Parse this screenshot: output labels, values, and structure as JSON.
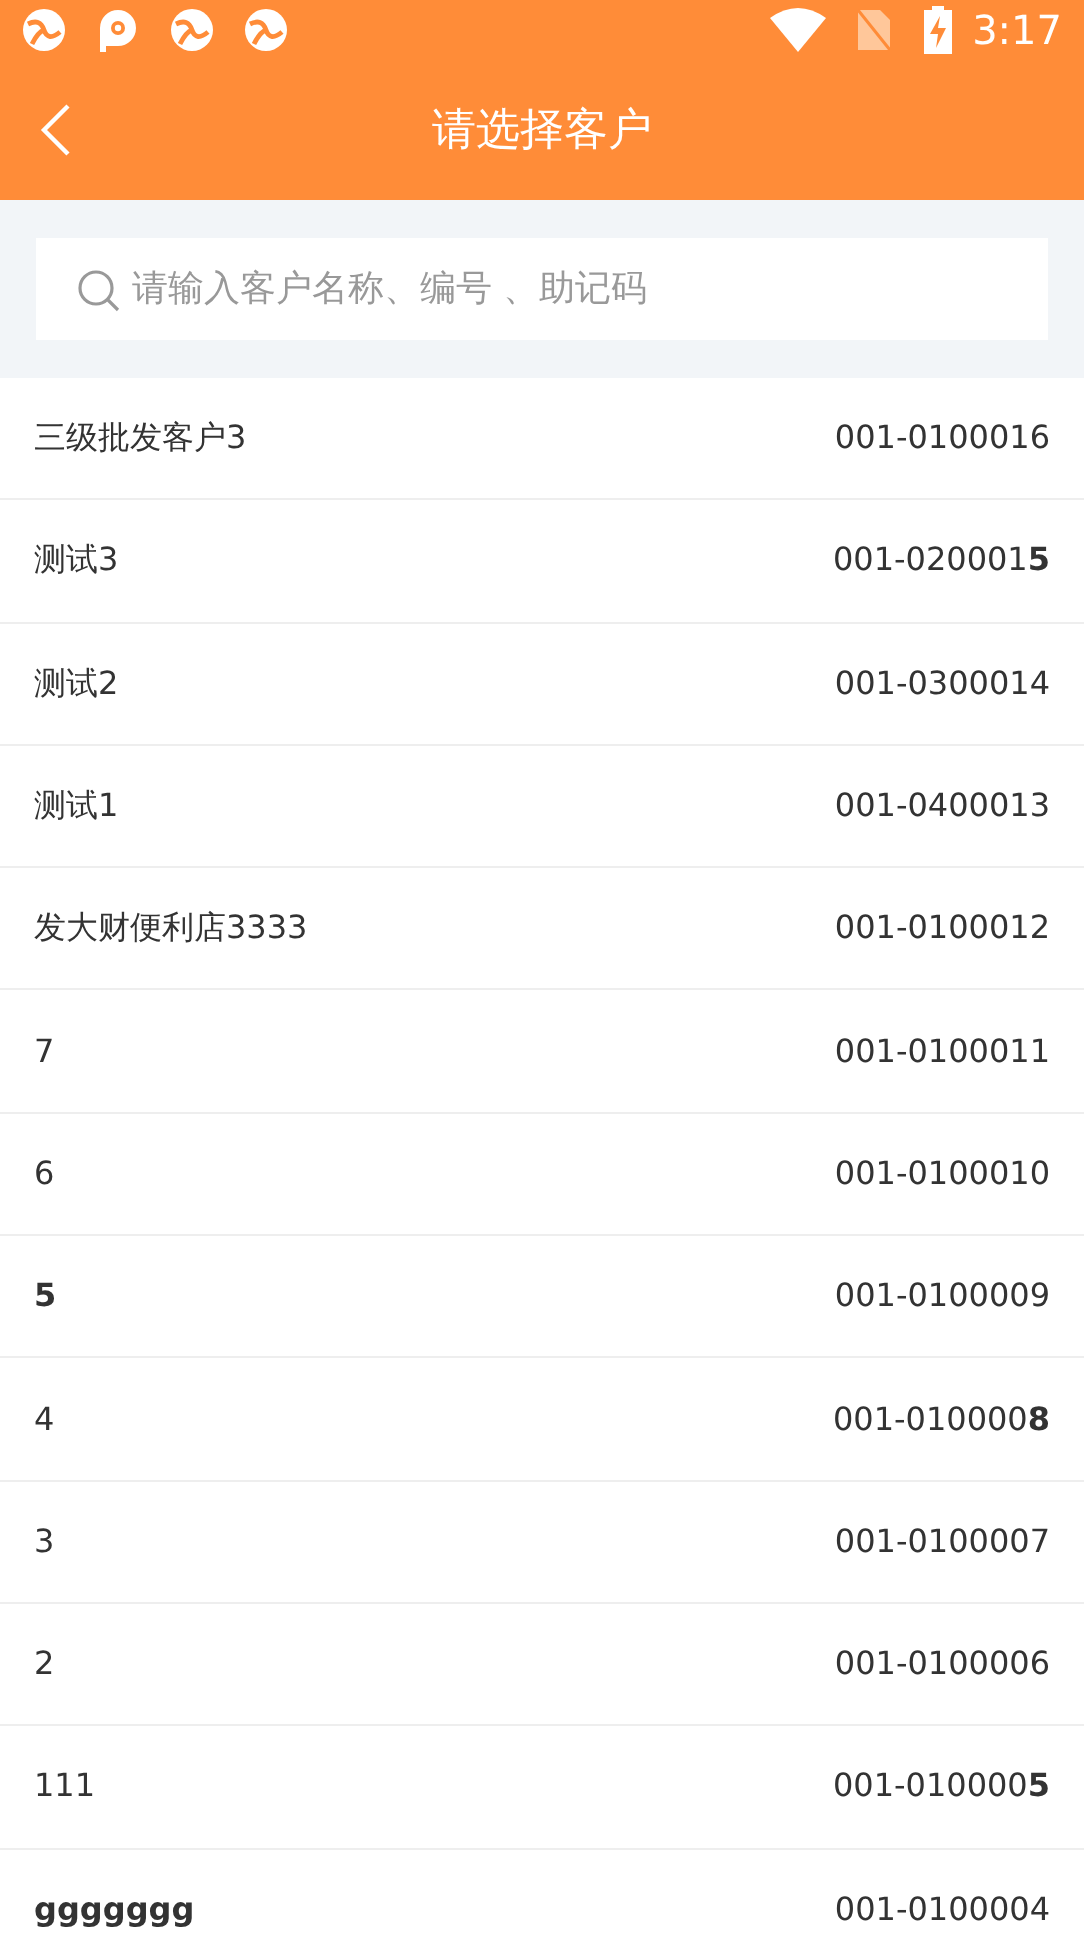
{
  "status_bar": {
    "time": "3:17"
  },
  "header": {
    "title": "请选择客户"
  },
  "search": {
    "placeholder": "请输入客户名称、编号 、助记码"
  },
  "customers": [
    {
      "name": "三级批发客户3",
      "code": "001-0100016",
      "bold": false
    },
    {
      "name": "测试3",
      "code": "001-020001**5**",
      "bold": false
    },
    {
      "name": "测试2",
      "code": "001-0300014",
      "bold": false
    },
    {
      "name": "测试1",
      "code": "001-0400013",
      "bold": false
    },
    {
      "name": "发大财便利店3333",
      "code": "001-0100012",
      "bold": false
    },
    {
      "name": "7",
      "code": "001-0100011",
      "bold": false
    },
    {
      "name": "6",
      "code": "001-0100010",
      "bold": false
    },
    {
      "name": "5",
      "code": "001-0100009",
      "bold": true
    },
    {
      "name": "4",
      "code": "001-010000**8**",
      "bold": false
    },
    {
      "name": "3",
      "code": "001-0100007",
      "bold": false
    },
    {
      "name": "2",
      "code": "001-0100006",
      "bold": false
    },
    {
      "name": "111",
      "code": "001-010000**5**",
      "bold": false
    },
    {
      "name": "ggggggg",
      "code": "001-0100004",
      "bold": true
    }
  ]
}
